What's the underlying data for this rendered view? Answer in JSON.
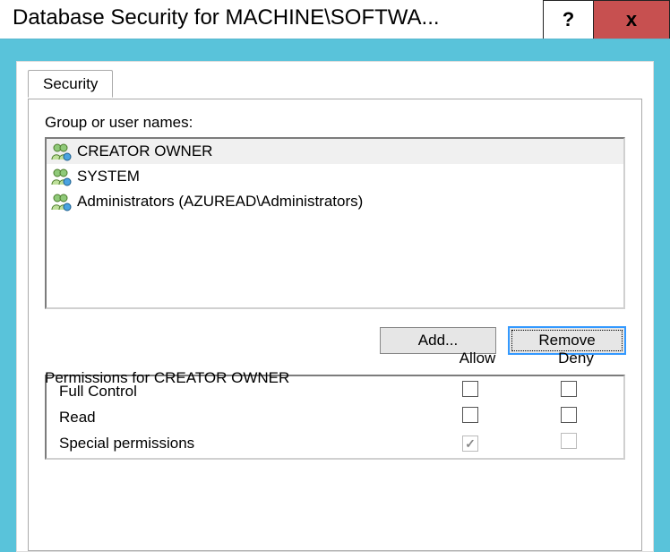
{
  "window": {
    "title": "Database Security for MACHINE\\SOFTWA...",
    "help_tooltip": "?",
    "close_tooltip": "x"
  },
  "tab": {
    "label": "Security"
  },
  "group_label": "Group or user names:",
  "users": [
    {
      "name": "CREATOR OWNER",
      "selected": true
    },
    {
      "name": "SYSTEM",
      "selected": false
    },
    {
      "name": "Administrators (AZUREAD\\Administrators)",
      "selected": false
    }
  ],
  "buttons": {
    "add": "Add...",
    "remove": "Remove"
  },
  "perm_label": "Permissions for CREATOR OWNER",
  "perm_cols": {
    "allow": "Allow",
    "deny": "Deny"
  },
  "permissions": [
    {
      "name": "Full Control",
      "allow": false,
      "deny": false,
      "disabled": false
    },
    {
      "name": "Read",
      "allow": false,
      "deny": false,
      "disabled": false
    },
    {
      "name": "Special permissions",
      "allow": true,
      "deny": false,
      "disabled": true
    }
  ]
}
